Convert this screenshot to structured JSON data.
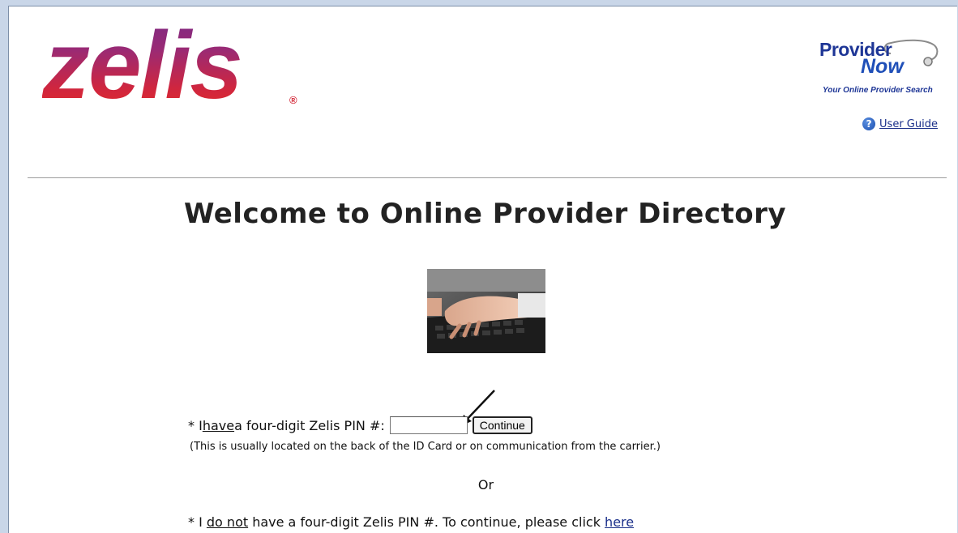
{
  "logo": {
    "text": "zelis",
    "registered": "®"
  },
  "provider_now": {
    "line1": "Provider",
    "line2": "Now",
    "tagline": "Your Online Provider Search"
  },
  "user_guide": {
    "label": "User Guide",
    "icon": "help-icon"
  },
  "title": "Welcome to Online Provider Directory",
  "pin_row": {
    "prefix": "* I ",
    "have": "have",
    "suffix": " a four-digit Zelis PIN #:",
    "input_value": "",
    "button_label": "Continue"
  },
  "note": "(This is usually located on the back of the ID Card or on communication from the carrier.)",
  "or_text": "Or",
  "no_pin_row": {
    "prefix": "* I ",
    "do_not": "do not",
    "middle": " have a four-digit Zelis PIN #. To continue, please click ",
    "link": "here"
  },
  "colors": {
    "link": "#1a2f8a",
    "brand_purple": "#7a2a86",
    "brand_red": "#e52b25",
    "provider_blue": "#1e3696"
  }
}
